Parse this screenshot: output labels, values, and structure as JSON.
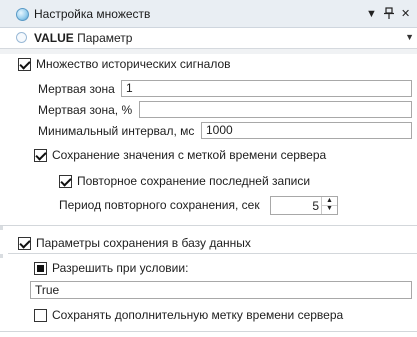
{
  "titlebar": {
    "title": "Настройка множеств",
    "dropdown_glyph": "▼",
    "pin_glyph": "ᚐ",
    "close_glyph": "✕"
  },
  "value_selector": {
    "bold": "VALUE",
    "text": "Параметр"
  },
  "history": {
    "enabled_label": "Множество исторических сигналов",
    "enabled": true,
    "deadband_label": "Мертвая зона",
    "deadband_value": "1",
    "deadband_pct_label": "Мертвая зона, %",
    "deadband_pct_value": "",
    "min_interval_label": "Минимальный интервал, мс",
    "min_interval_value": "1000",
    "server_ts_label": "Сохранение значения с меткой времени сервера",
    "server_ts_checked": true,
    "resave_label": "Повторное сохранение последней записи",
    "resave_checked": true,
    "resave_period_label": "Период повторного сохранения, сек",
    "resave_period_value": "5"
  },
  "db": {
    "params_label": "Параметры сохранения в базу данных",
    "params_checked": true,
    "condition_label": "Разрешить при условии:",
    "condition_state": "indeterminate",
    "condition_value": "True",
    "extra_ts_label": "Сохранять дополнительную метку времени сервера",
    "extra_ts_checked": false
  }
}
